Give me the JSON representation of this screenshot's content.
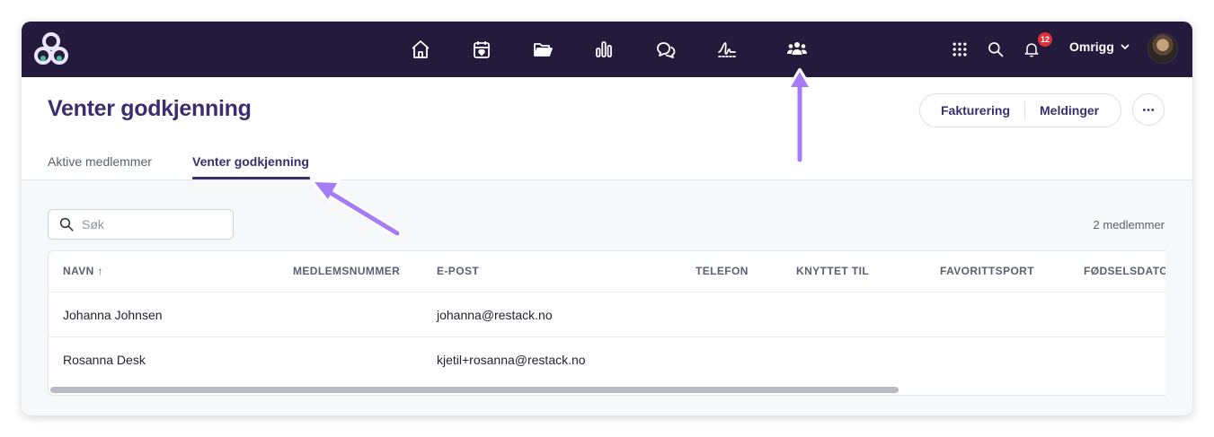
{
  "topbar": {
    "nav_icons": [
      "home-icon",
      "calendar-heart-icon",
      "folder-icon",
      "bar-chart-icon",
      "chat-icon",
      "signature-icon",
      "members-icon"
    ],
    "notification_count": "12",
    "org_name": "Omrigg"
  },
  "header": {
    "title": "Venter godkjenning",
    "actions": {
      "invoicing": "Fakturering",
      "messages": "Meldinger"
    },
    "tabs": {
      "active_members": "Aktive medlemmer",
      "pending": "Venter godkjenning"
    }
  },
  "toolbar": {
    "search_placeholder": "Søk",
    "member_count": "2 medlemmer"
  },
  "table": {
    "columns": {
      "name": "NAVN ↑",
      "member_number": "MEDLEMSNUMMER",
      "email": "E-POST",
      "phone": "TELEFON",
      "linked_to": "KNYTTET TIL",
      "favorite_sport": "FAVORITTSPORT",
      "birthdate": "FØDSELSDATO"
    },
    "rows": [
      {
        "name": "Johanna Johnsen",
        "email": "johanna@restack.no"
      },
      {
        "name": "Rosanna Desk",
        "email": "kjetil+rosanna@restack.no"
      }
    ]
  },
  "colors": {
    "topbar": "#241a3b",
    "accent": "#3b2e6e",
    "arrow": "#a57cf5"
  }
}
